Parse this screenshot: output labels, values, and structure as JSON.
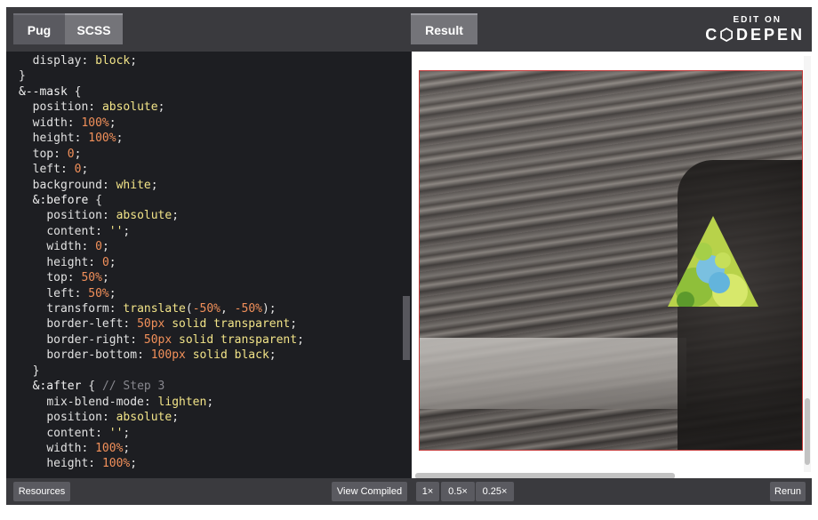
{
  "tabs": {
    "pug": "Pug",
    "scss": "SCSS",
    "result": "Result"
  },
  "brand": {
    "edit_on": "EDIT ON",
    "codepen": "C⬡DEPEN"
  },
  "code_lines": [
    [
      [
        "  ",
        "punc"
      ],
      [
        "display",
        "prop"
      ],
      [
        ": ",
        "punc"
      ],
      [
        "block",
        "v-kw"
      ],
      [
        ";",
        "punc"
      ]
    ],
    [
      [
        "}",
        "punc"
      ]
    ],
    [
      [
        "&",
        "sel"
      ],
      [
        "--mask",
        "sel"
      ],
      [
        " {",
        "punc"
      ]
    ],
    [
      [
        "  ",
        "punc"
      ],
      [
        "position",
        "prop"
      ],
      [
        ": ",
        "punc"
      ],
      [
        "absolute",
        "v-kw"
      ],
      [
        ";",
        "punc"
      ]
    ],
    [
      [
        "  ",
        "punc"
      ],
      [
        "width",
        "prop"
      ],
      [
        ": ",
        "punc"
      ],
      [
        "100%",
        "v-num"
      ],
      [
        ";",
        "punc"
      ]
    ],
    [
      [
        "  ",
        "punc"
      ],
      [
        "height",
        "prop"
      ],
      [
        ": ",
        "punc"
      ],
      [
        "100%",
        "v-num"
      ],
      [
        ";",
        "punc"
      ]
    ],
    [
      [
        "  ",
        "punc"
      ],
      [
        "top",
        "prop"
      ],
      [
        ": ",
        "punc"
      ],
      [
        "0",
        "v-num"
      ],
      [
        ";",
        "punc"
      ]
    ],
    [
      [
        "  ",
        "punc"
      ],
      [
        "left",
        "prop"
      ],
      [
        ": ",
        "punc"
      ],
      [
        "0",
        "v-num"
      ],
      [
        ";",
        "punc"
      ]
    ],
    [
      [
        "  ",
        "punc"
      ],
      [
        "background",
        "prop"
      ],
      [
        ": ",
        "punc"
      ],
      [
        "white",
        "v-kw"
      ],
      [
        ";",
        "punc"
      ]
    ],
    [
      [
        "  ",
        "punc"
      ],
      [
        "&:before",
        "sel"
      ],
      [
        " {",
        "punc"
      ]
    ],
    [
      [
        "    ",
        "punc"
      ],
      [
        "position",
        "prop"
      ],
      [
        ": ",
        "punc"
      ],
      [
        "absolute",
        "v-kw"
      ],
      [
        ";",
        "punc"
      ]
    ],
    [
      [
        "    ",
        "punc"
      ],
      [
        "content",
        "prop"
      ],
      [
        ": ",
        "punc"
      ],
      [
        "''",
        "v-str"
      ],
      [
        ";",
        "punc"
      ]
    ],
    [
      [
        "    ",
        "punc"
      ],
      [
        "width",
        "prop"
      ],
      [
        ": ",
        "punc"
      ],
      [
        "0",
        "v-num"
      ],
      [
        ";",
        "punc"
      ]
    ],
    [
      [
        "    ",
        "punc"
      ],
      [
        "height",
        "prop"
      ],
      [
        ": ",
        "punc"
      ],
      [
        "0",
        "v-num"
      ],
      [
        ";",
        "punc"
      ]
    ],
    [
      [
        "    ",
        "punc"
      ],
      [
        "top",
        "prop"
      ],
      [
        ": ",
        "punc"
      ],
      [
        "50%",
        "v-num"
      ],
      [
        ";",
        "punc"
      ]
    ],
    [
      [
        "    ",
        "punc"
      ],
      [
        "left",
        "prop"
      ],
      [
        ": ",
        "punc"
      ],
      [
        "50%",
        "v-num"
      ],
      [
        ";",
        "punc"
      ]
    ],
    [
      [
        "    ",
        "punc"
      ],
      [
        "transform",
        "prop"
      ],
      [
        ": ",
        "punc"
      ],
      [
        "translate",
        "v-kw"
      ],
      [
        "(",
        "punc"
      ],
      [
        "-50%",
        "v-num"
      ],
      [
        ", ",
        "punc"
      ],
      [
        "-50%",
        "v-num"
      ],
      [
        ");",
        "punc"
      ]
    ],
    [
      [
        "    ",
        "punc"
      ],
      [
        "border-left",
        "prop"
      ],
      [
        ": ",
        "punc"
      ],
      [
        "50px",
        "v-num"
      ],
      [
        " ",
        "punc"
      ],
      [
        "solid transparent",
        "v-kw"
      ],
      [
        ";",
        "punc"
      ]
    ],
    [
      [
        "    ",
        "punc"
      ],
      [
        "border-right",
        "prop"
      ],
      [
        ": ",
        "punc"
      ],
      [
        "50px",
        "v-num"
      ],
      [
        " ",
        "punc"
      ],
      [
        "solid transparent",
        "v-kw"
      ],
      [
        ";",
        "punc"
      ]
    ],
    [
      [
        "    ",
        "punc"
      ],
      [
        "border-bottom",
        "prop"
      ],
      [
        ": ",
        "punc"
      ],
      [
        "100px",
        "v-num"
      ],
      [
        " ",
        "punc"
      ],
      [
        "solid black",
        "v-kw"
      ],
      [
        ";",
        "punc"
      ]
    ],
    [
      [
        "  ",
        "punc"
      ],
      [
        "}",
        "punc"
      ]
    ],
    [
      [
        "  ",
        "punc"
      ],
      [
        "&:after",
        "sel"
      ],
      [
        " { ",
        "punc"
      ],
      [
        "// Step 3",
        "cm"
      ]
    ],
    [
      [
        "    ",
        "punc"
      ],
      [
        "mix-blend-mode",
        "prop"
      ],
      [
        ": ",
        "punc"
      ],
      [
        "lighten",
        "v-kw"
      ],
      [
        ";",
        "punc"
      ]
    ],
    [
      [
        "    ",
        "punc"
      ],
      [
        "position",
        "prop"
      ],
      [
        ": ",
        "punc"
      ],
      [
        "absolute",
        "v-kw"
      ],
      [
        ";",
        "punc"
      ]
    ],
    [
      [
        "    ",
        "punc"
      ],
      [
        "content",
        "prop"
      ],
      [
        ": ",
        "punc"
      ],
      [
        "''",
        "v-str"
      ],
      [
        ";",
        "punc"
      ]
    ],
    [
      [
        "    ",
        "punc"
      ],
      [
        "width",
        "prop"
      ],
      [
        ": ",
        "punc"
      ],
      [
        "100%",
        "v-num"
      ],
      [
        ";",
        "punc"
      ]
    ],
    [
      [
        "    ",
        "punc"
      ],
      [
        "height",
        "prop"
      ],
      [
        ": ",
        "punc"
      ],
      [
        "100%",
        "v-num"
      ],
      [
        ";",
        "punc"
      ]
    ]
  ],
  "bottom": {
    "resources": "Resources",
    "view_compiled": "View Compiled",
    "zoom_1x": "1×",
    "zoom_05x": "0.5×",
    "zoom_025x": "0.25×",
    "rerun": "Rerun"
  },
  "colors": {
    "editor_bg": "#1d1e22",
    "bar_bg": "#3a3a3e",
    "keyword": "#f2e488",
    "number": "#f2905a",
    "comment": "#87878e"
  }
}
